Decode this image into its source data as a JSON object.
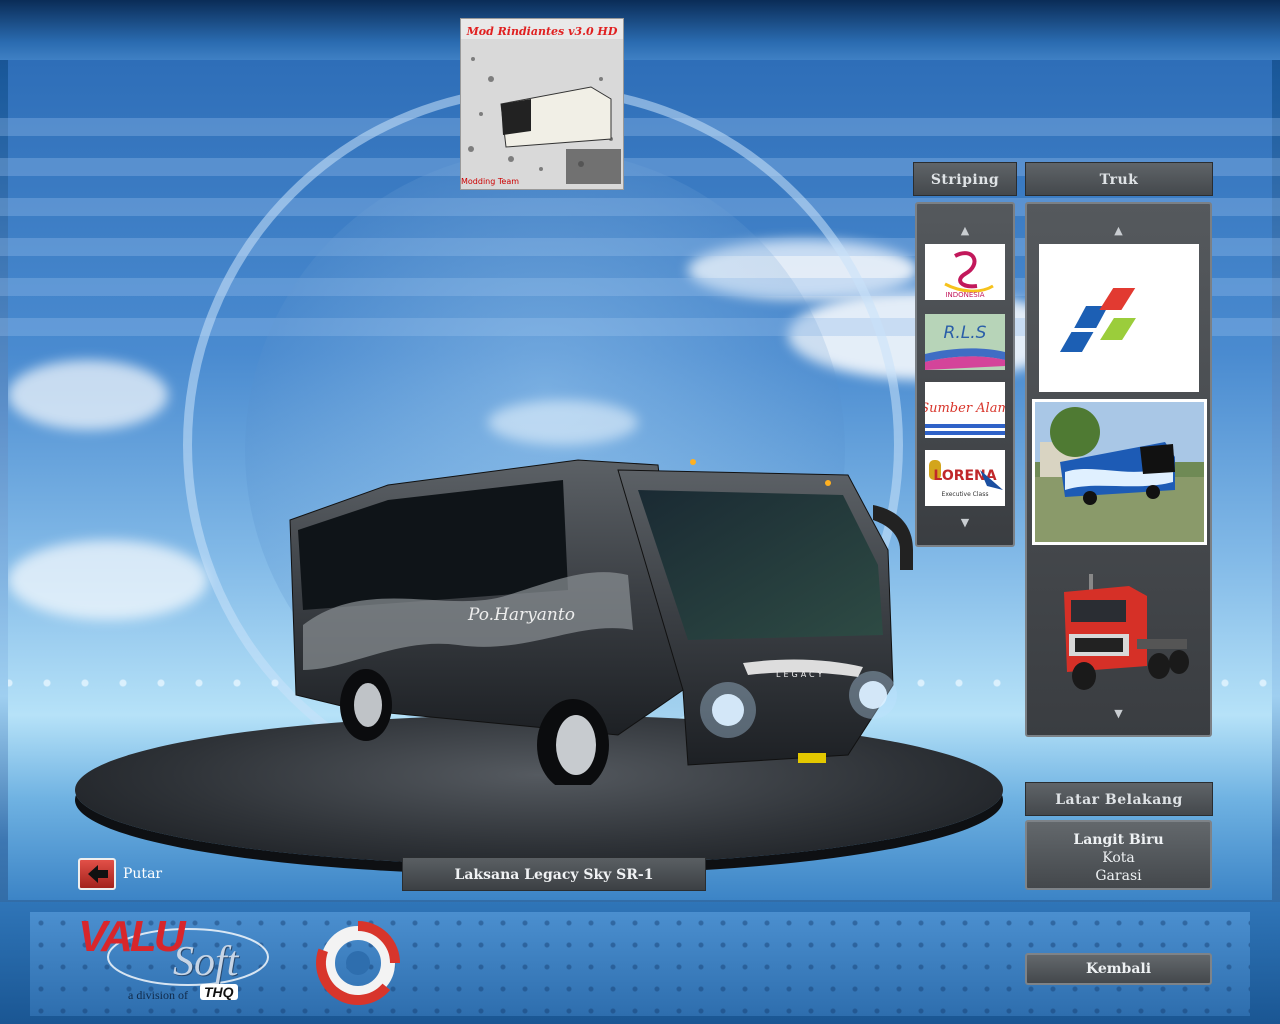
{
  "preview_image": {
    "title_text": "Mod Rindiantes v3.0 HD",
    "footer_text": "Modding Team",
    "icon": "bus-preview-thumbnail"
  },
  "striping": {
    "label": "Striping",
    "up_arrow": "▲",
    "down_arrow": "▼",
    "items": [
      {
        "name": "rosalia-indah-stripe",
        "text": "INDONESIA"
      },
      {
        "name": "rls-stripe",
        "text": "R.L.S"
      },
      {
        "name": "sumber-alam-stripe",
        "text": "Sumber Alam"
      },
      {
        "name": "lorena-stripe",
        "text": "LORENA",
        "subtext": "Executive Class"
      }
    ]
  },
  "truck": {
    "label": "Truk",
    "up_arrow": "▲",
    "down_arrow": "▼",
    "items": [
      {
        "name": "pertamina-logo",
        "selected": false
      },
      {
        "name": "bus-in-lot-preview",
        "selected": true
      },
      {
        "name": "red-truck-preview",
        "selected": false
      }
    ]
  },
  "background": {
    "label": "Latar Belakang",
    "options": [
      "Langit Biru",
      "Kota",
      "Garasi"
    ]
  },
  "rotate_label": "Putar",
  "vehicle_name": "Laksana Legacy Sky SR-1",
  "bus": {
    "livery_text": "Po.Haryanto",
    "grille_text": "LEGACY"
  },
  "back_button": "Kembali",
  "publisher": {
    "logo_main": "VALU",
    "logo_soft": "Soft",
    "division": "a division of",
    "parent": "THQ"
  },
  "colors": {
    "sky": "#4a8bd0",
    "panel": "#44484c",
    "accent_red": "#d8352b"
  }
}
